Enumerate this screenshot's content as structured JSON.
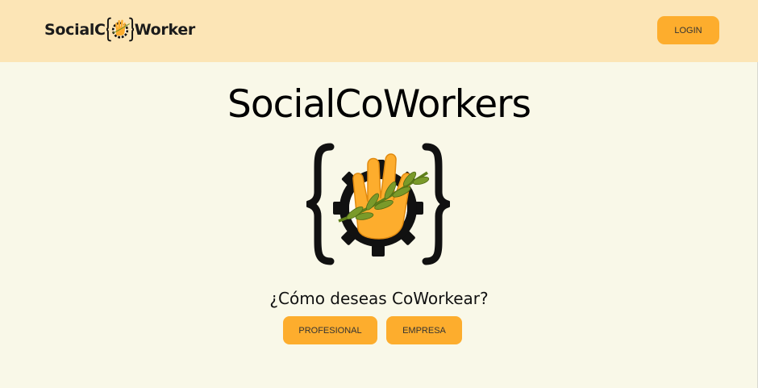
{
  "header": {
    "brand_prefix": "SocialC",
    "brand_suffix": "Worker",
    "login_label": "LOGIN"
  },
  "hero": {
    "title": "SocialCoWorkers",
    "logo_icon": "gear-hand-olive-branch-logo",
    "question": "¿Cómo deseas CoWorkear?",
    "options": [
      {
        "label": "PROFESIONAL"
      },
      {
        "label": "EMPRESA"
      }
    ]
  },
  "colors": {
    "header_bg": "#fce5b6",
    "page_bg": "#f9f8e8",
    "accent": "#fdad2d",
    "leaf": "#7a9a2a"
  }
}
